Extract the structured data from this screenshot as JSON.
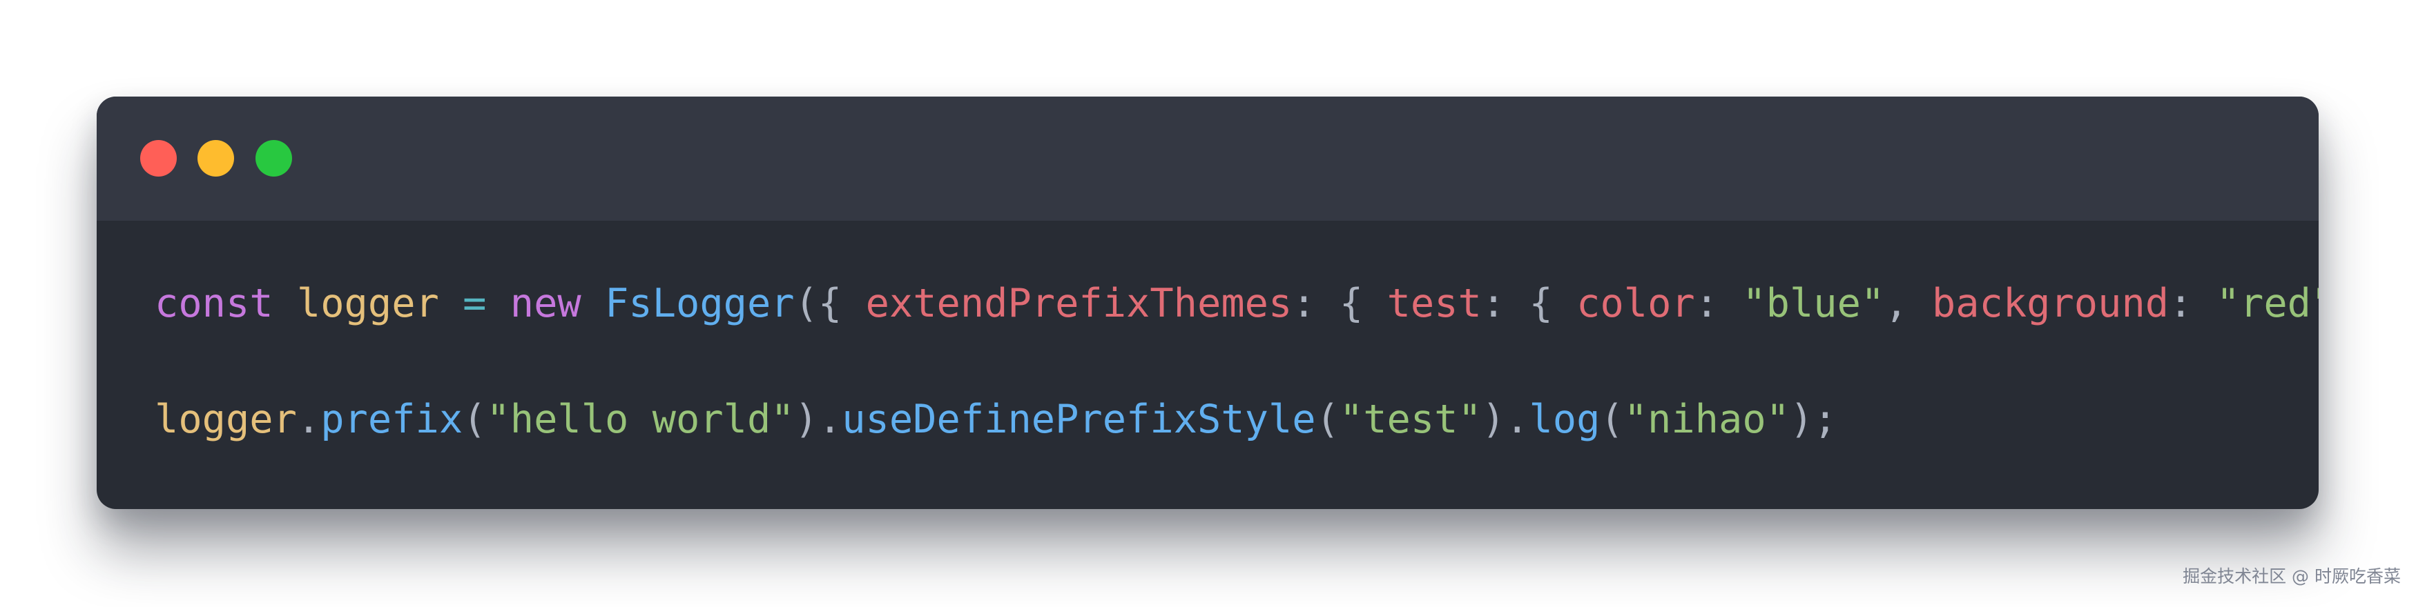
{
  "window_controls": {
    "close_color": "#ff5f57",
    "minimize_color": "#febc2e",
    "maximize_color": "#28c840"
  },
  "code": {
    "lines": [
      [
        {
          "text": "const",
          "color": "#c678dd"
        },
        {
          "text": " ",
          "color": "#abb2bf"
        },
        {
          "text": "logger",
          "color": "#e5c07b"
        },
        {
          "text": " = ",
          "color": "#56b6c2"
        },
        {
          "text": "new",
          "color": "#c678dd"
        },
        {
          "text": " ",
          "color": "#abb2bf"
        },
        {
          "text": "FsLogger",
          "color": "#61afef"
        },
        {
          "text": "({ ",
          "color": "#abb2bf"
        },
        {
          "text": "extendPrefixThemes",
          "color": "#e06c75"
        },
        {
          "text": ": { ",
          "color": "#abb2bf"
        },
        {
          "text": "test",
          "color": "#e06c75"
        },
        {
          "text": ": { ",
          "color": "#abb2bf"
        },
        {
          "text": "color",
          "color": "#e06c75"
        },
        {
          "text": ": ",
          "color": "#abb2bf"
        },
        {
          "text": "\"blue\"",
          "color": "#98c379"
        },
        {
          "text": ", ",
          "color": "#abb2bf"
        },
        {
          "text": "background",
          "color": "#e06c75"
        },
        {
          "text": ": ",
          "color": "#abb2bf"
        },
        {
          "text": "\"red\"",
          "color": "#98c379"
        },
        {
          "text": " } } });",
          "color": "#abb2bf"
        }
      ],
      [
        {
          "text": "logger",
          "color": "#e5c07b"
        },
        {
          "text": ".",
          "color": "#abb2bf"
        },
        {
          "text": "prefix",
          "color": "#61afef"
        },
        {
          "text": "(",
          "color": "#abb2bf"
        },
        {
          "text": "\"hello world\"",
          "color": "#98c379"
        },
        {
          "text": ").",
          "color": "#abb2bf"
        },
        {
          "text": "useDefinePrefixStyle",
          "color": "#61afef"
        },
        {
          "text": "(",
          "color": "#abb2bf"
        },
        {
          "text": "\"test\"",
          "color": "#98c379"
        },
        {
          "text": ").",
          "color": "#abb2bf"
        },
        {
          "text": "log",
          "color": "#61afef"
        },
        {
          "text": "(",
          "color": "#abb2bf"
        },
        {
          "text": "\"nihao\"",
          "color": "#98c379"
        },
        {
          "text": ");",
          "color": "#abb2bf"
        }
      ]
    ]
  },
  "watermark": {
    "text": "掘金技术社区 @ 时厥吃香菜"
  }
}
